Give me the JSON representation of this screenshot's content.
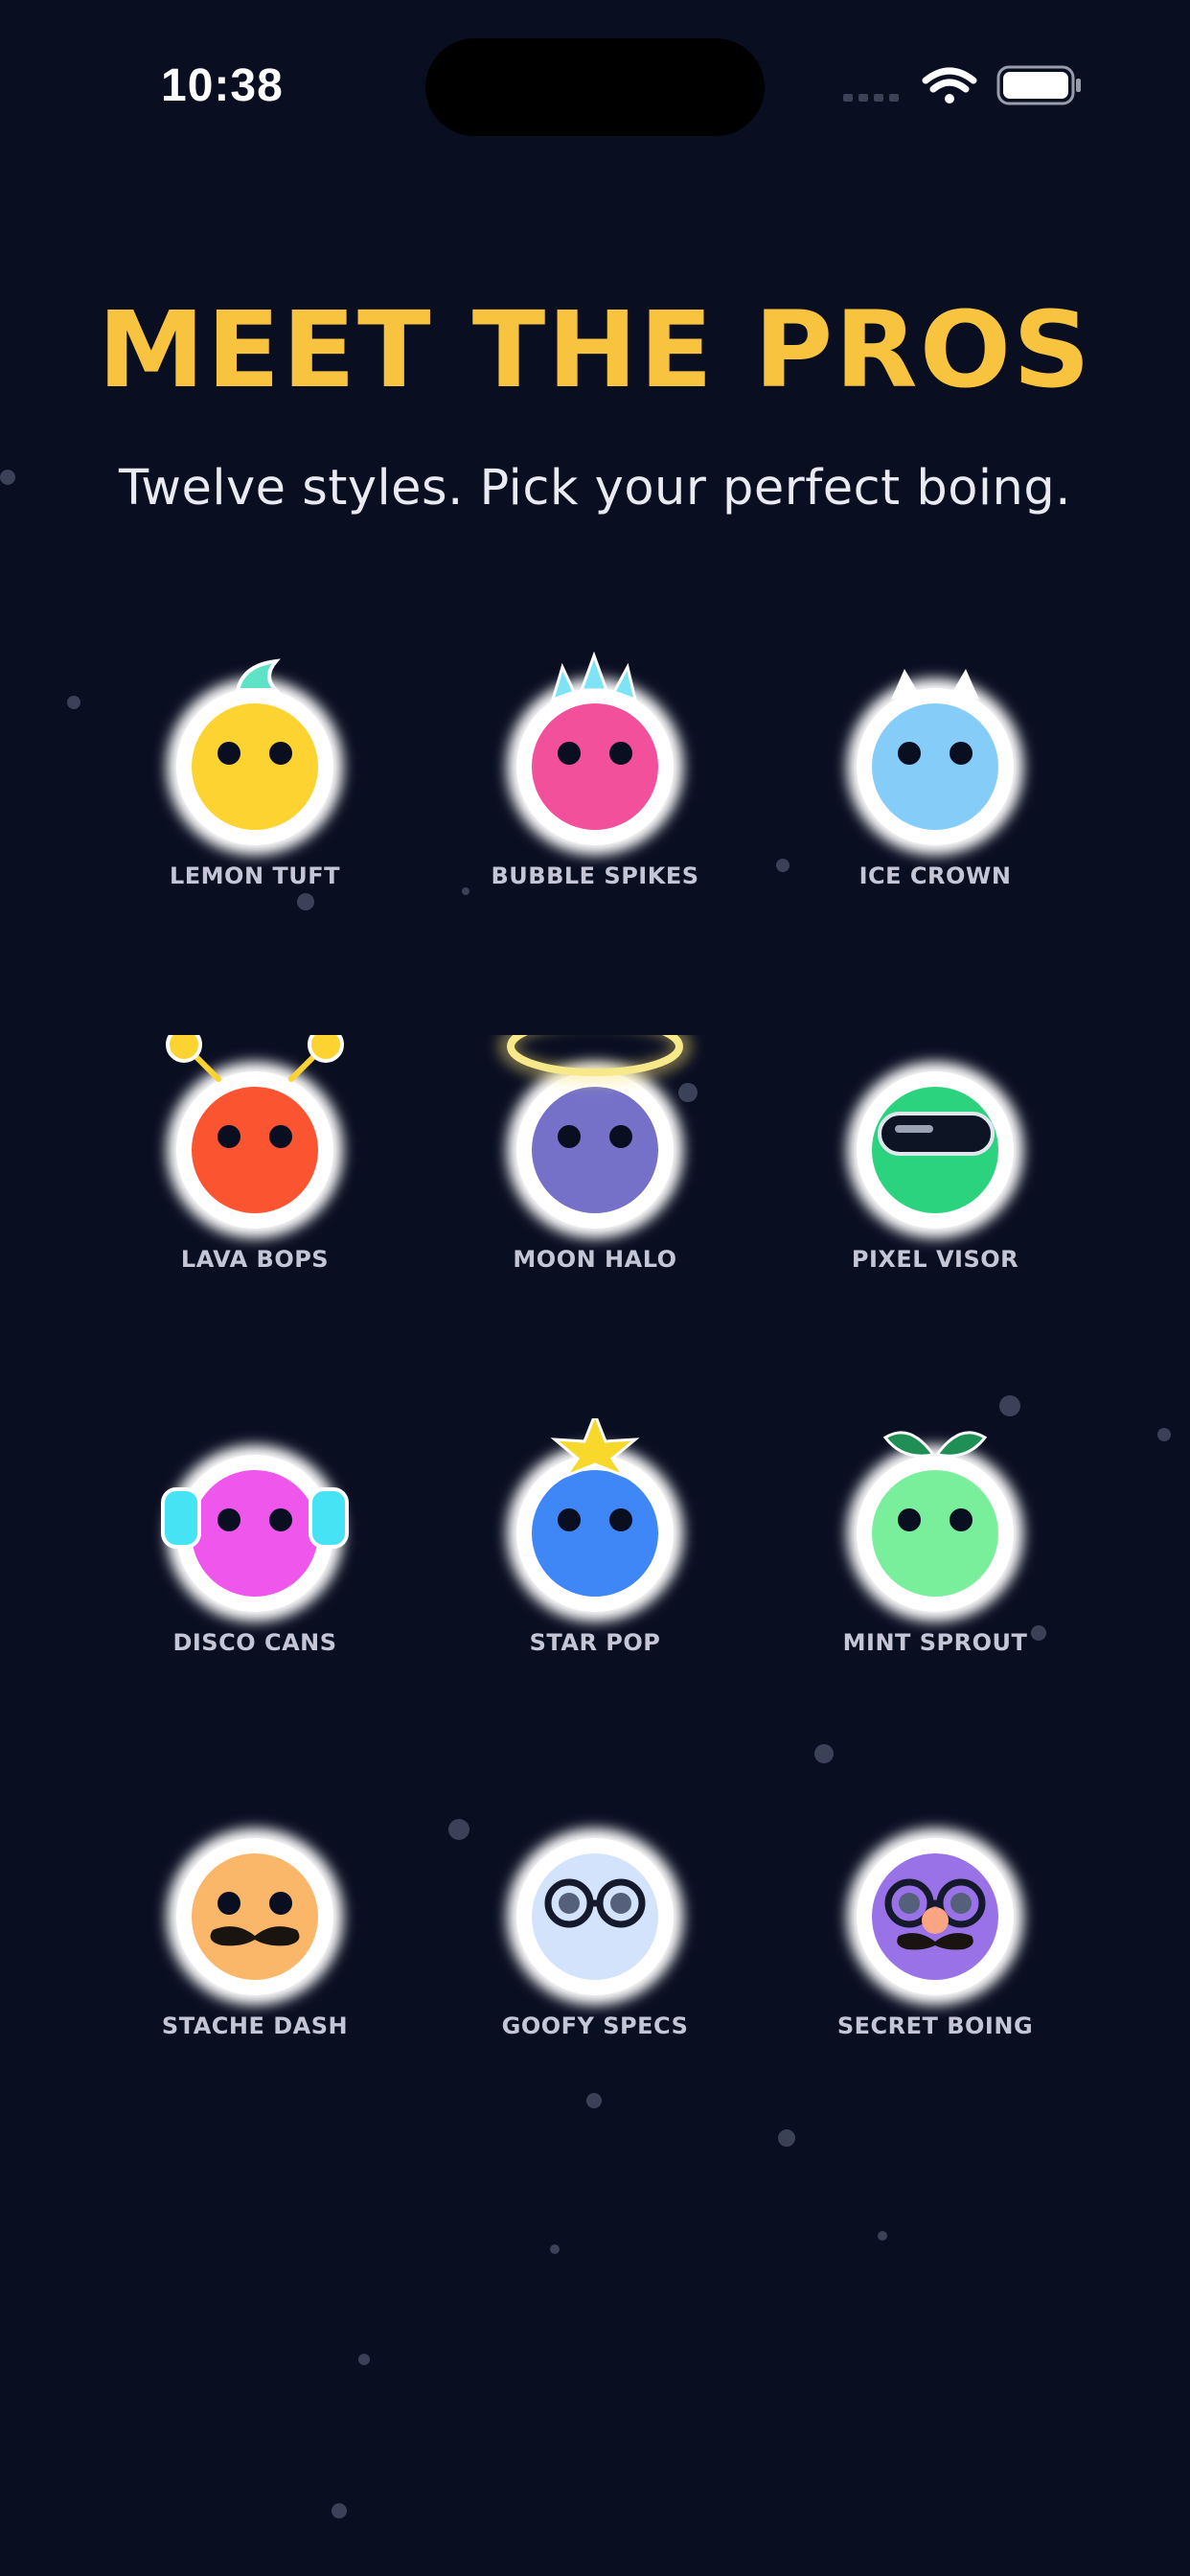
{
  "status_bar": {
    "time": "10:38"
  },
  "header": {
    "title": "MEET THE PROS",
    "subtitle": "Twelve styles. Pick your perfect boing."
  },
  "colors": {
    "background": "#0a0e21",
    "title": "#f8c440",
    "label": "#c4c6d6"
  },
  "characters": [
    {
      "name": "LEMON TUFT",
      "body_color": "#fdd331",
      "accessory": "tuft-icon"
    },
    {
      "name": "BUBBLE SPIKES",
      "body_color": "#f2509a",
      "accessory": "spikes-icon"
    },
    {
      "name": "ICE CROWN",
      "body_color": "#86ccf9",
      "accessory": "crown-icon"
    },
    {
      "name": "LAVA BOPS",
      "body_color": "#fa5430",
      "accessory": "antennae-icon"
    },
    {
      "name": "MOON HALO",
      "body_color": "#7571c8",
      "accessory": "halo-icon"
    },
    {
      "name": "PIXEL VISOR",
      "body_color": "#2bd37f",
      "accessory": "visor-icon"
    },
    {
      "name": "DISCO CANS",
      "body_color": "#ee56ec",
      "accessory": "headphones-icon"
    },
    {
      "name": "STAR POP",
      "body_color": "#3f86f7",
      "accessory": "star-icon"
    },
    {
      "name": "MINT SPROUT",
      "body_color": "#79ef9b",
      "accessory": "sprout-icon"
    },
    {
      "name": "STACHE DASH",
      "body_color": "#fab769",
      "accessory": "mustache-icon"
    },
    {
      "name": "GOOFY SPECS",
      "body_color": "#d3e3fc",
      "accessory": "glasses-icon"
    },
    {
      "name": "SECRET BOING",
      "body_color": "#9a72e7",
      "accessory": "disguise-icon"
    }
  ]
}
